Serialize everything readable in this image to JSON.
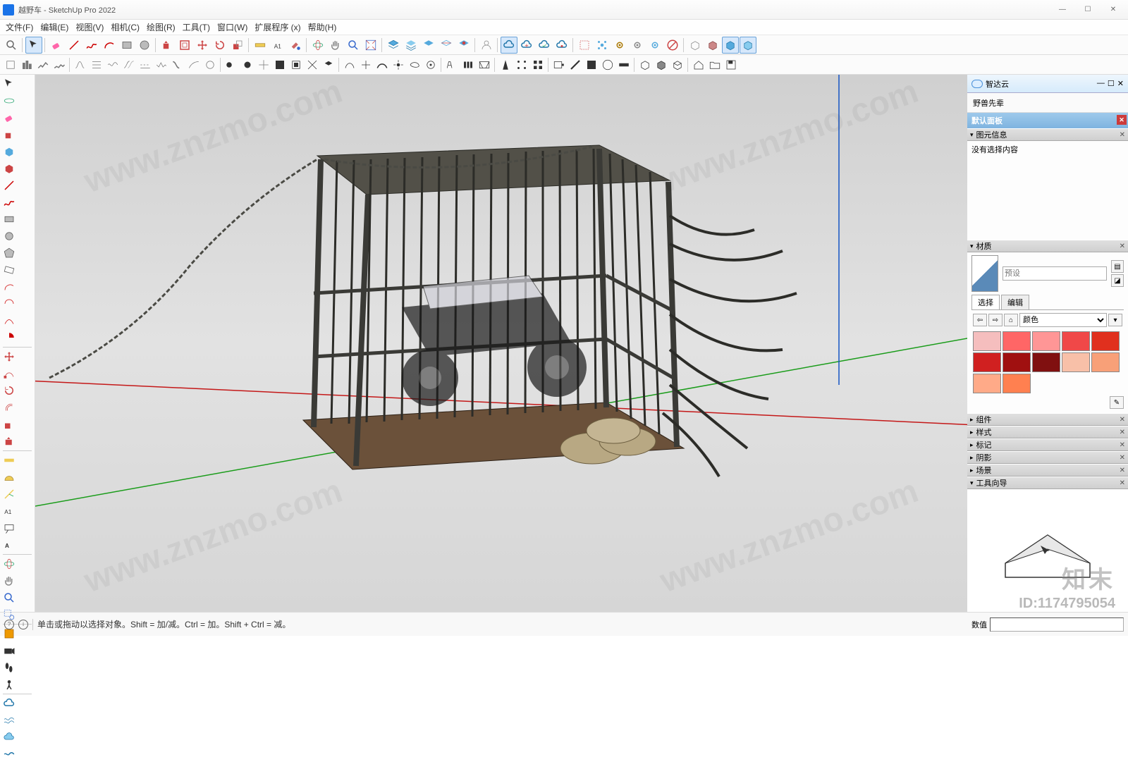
{
  "titlebar": {
    "title": "越野车 - SketchUp Pro 2022"
  },
  "menus": [
    "文件(F)",
    "编辑(E)",
    "视图(V)",
    "相机(C)",
    "绘图(R)",
    "工具(T)",
    "窗口(W)",
    "扩展程序 (x)",
    "帮助(H)"
  ],
  "zhida": {
    "title": "智达云",
    "body": "野兽先辈"
  },
  "tray": {
    "title": "默认面板"
  },
  "panels": {
    "entity": {
      "title": "图元信息",
      "body": "没有选择内容"
    },
    "materials": {
      "title": "材质",
      "preset_label": "预设",
      "tab_select": "选择",
      "tab_edit": "编辑",
      "category": "颜色"
    },
    "components": {
      "title": "组件"
    },
    "styles": {
      "title": "样式"
    },
    "tags": {
      "title": "标记"
    },
    "shadows": {
      "title": "阴影"
    },
    "scenes": {
      "title": "场景"
    },
    "instructor": {
      "title": "工具向导"
    }
  },
  "colors": [
    "#f5bebe",
    "#ff6666",
    "#ff9696",
    "#f04848",
    "#e0301e",
    "#d02020",
    "#a01010",
    "#801010",
    "#f8c0a8",
    "#f8a078",
    "#ffaa88",
    "#ff8050"
  ],
  "status": {
    "hint": "单击或拖动以选择对象。Shift = 加/减。Ctrl = 加。Shift + Ctrl = 减。",
    "value_label": "数值"
  },
  "watermark": {
    "text": "www.znzmo.com",
    "logo": "知末",
    "id": "ID:1174795054"
  },
  "zhida_wins": {
    "min": "—",
    "max": "☐",
    "close": "✕"
  }
}
